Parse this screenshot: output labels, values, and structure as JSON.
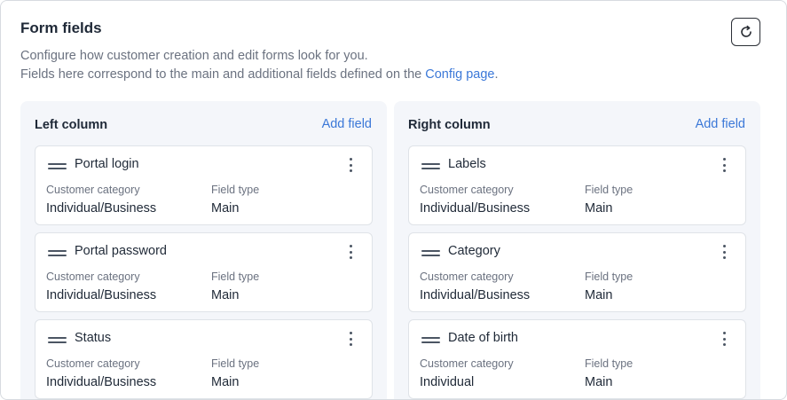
{
  "header": {
    "title": "Form fields",
    "description_line1": "Configure how customer creation and edit forms look for you.",
    "description_line2_prefix": "Fields here correspond to the main and additional fields defined on the ",
    "description_link": "Config page",
    "description_line2_suffix": ".",
    "refresh_icon": "refresh-icon"
  },
  "left_column": {
    "title": "Left column",
    "add_label": "Add field",
    "cards": [
      {
        "name": "Portal login",
        "category_label": "Customer category",
        "category": "Individual/Business",
        "type_label": "Field type",
        "type": "Main"
      },
      {
        "name": "Portal password",
        "category_label": "Customer category",
        "category": "Individual/Business",
        "type_label": "Field type",
        "type": "Main"
      },
      {
        "name": "Status",
        "category_label": "Customer category",
        "category": "Individual/Business",
        "type_label": "Field type",
        "type": "Main"
      }
    ]
  },
  "right_column": {
    "title": "Right column",
    "add_label": "Add field",
    "cards": [
      {
        "name": "Labels",
        "category_label": "Customer category",
        "category": "Individual/Business",
        "type_label": "Field type",
        "type": "Main"
      },
      {
        "name": "Category",
        "category_label": "Customer category",
        "category": "Individual/Business",
        "type_label": "Field type",
        "type": "Main"
      },
      {
        "name": "Date of birth",
        "category_label": "Customer category",
        "category": "Individual",
        "type_label": "Field type",
        "type": "Main"
      }
    ]
  },
  "colors": {
    "accent": "#3b78d8",
    "column_bg": "#f4f6fa",
    "border": "#dfe3e8"
  }
}
